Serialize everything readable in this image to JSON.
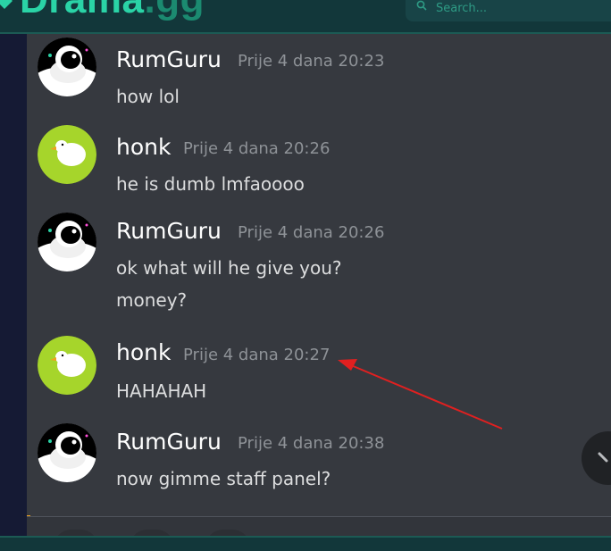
{
  "brand": {
    "name": "Drama",
    "ext": ".gg",
    "brand_color": "#2ad3a6"
  },
  "search": {
    "placeholder": "Search..."
  },
  "messages": [
    {
      "author": "RumGuru",
      "timestamp": "Prije 4 dana 20:23",
      "avatar": "astronaut-avatar",
      "lines": [
        "how lol"
      ]
    },
    {
      "author": "honk",
      "timestamp": "Prije 4 dana 20:26",
      "avatar": "goose-avatar",
      "lines": [
        "he is dumb lmfaoooo"
      ]
    },
    {
      "author": "RumGuru",
      "timestamp": "Prije 4 dana 20:26",
      "avatar": "astronaut-avatar",
      "lines": [
        "ok what will he give you?",
        "money?"
      ]
    },
    {
      "author": "honk",
      "timestamp": "Prije 4 dana 20:27",
      "avatar": "goose-avatar",
      "lines": [
        "HAHAHAH"
      ]
    },
    {
      "author": "RumGuru",
      "timestamp": "Prije 4 dana 20:38",
      "avatar": "astronaut-avatar",
      "lines": [
        "now gimme staff panel?"
      ]
    }
  ],
  "annotation": {
    "type": "red-arrow",
    "points_to": "timestamp of honk message 20:27",
    "color": "#e02020"
  },
  "colors": {
    "chat_bg": "#36393f",
    "author": "#ffffff",
    "timestamp": "#8e9297",
    "text": "#dcddde",
    "goose_bg": "#a6d52b"
  }
}
